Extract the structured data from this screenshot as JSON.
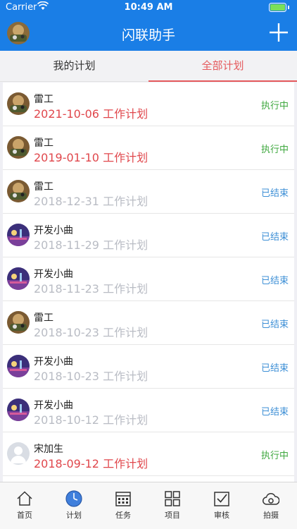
{
  "status_bar": {
    "carrier": "Carrier",
    "time": "10:49 AM"
  },
  "navbar": {
    "title": "闪联助手"
  },
  "tabs": [
    {
      "label": "我的计划",
      "selected": false
    },
    {
      "label": "全部计划",
      "selected": true
    }
  ],
  "plans": [
    {
      "name": "雷工",
      "date": "2021-10-06",
      "suffix": "工作计划",
      "status": "执行中",
      "status_type": "running",
      "avatar": "avatar-photo-1"
    },
    {
      "name": "雷工",
      "date": "2019-01-10",
      "suffix": "工作计划",
      "status": "执行中",
      "status_type": "running",
      "avatar": "avatar-photo-1"
    },
    {
      "name": "雷工",
      "date": "2018-12-31",
      "suffix": "工作计划",
      "status": "已结束",
      "status_type": "ended",
      "avatar": "avatar-photo-1"
    },
    {
      "name": "开发小曲",
      "date": "2018-11-29",
      "suffix": "工作计划",
      "status": "已结束",
      "status_type": "ended",
      "avatar": "avatar-photo-2"
    },
    {
      "name": "开发小曲",
      "date": "2018-11-23",
      "suffix": "工作计划",
      "status": "已结束",
      "status_type": "ended",
      "avatar": "avatar-photo-2"
    },
    {
      "name": "雷工",
      "date": "2018-10-23",
      "suffix": "工作计划",
      "status": "已结束",
      "status_type": "ended",
      "avatar": "avatar-photo-1"
    },
    {
      "name": "开发小曲",
      "date": "2018-10-23",
      "suffix": "工作计划",
      "status": "已结束",
      "status_type": "ended",
      "avatar": "avatar-photo-2"
    },
    {
      "name": "开发小曲",
      "date": "2018-10-12",
      "suffix": "工作计划",
      "status": "已结束",
      "status_type": "ended",
      "avatar": "avatar-photo-2"
    },
    {
      "name": "宋加生",
      "date": "2018-09-12",
      "suffix": "工作计划",
      "status": "执行中",
      "status_type": "running",
      "avatar": "avatar-default"
    }
  ],
  "tab_bar": [
    {
      "label": "首页",
      "icon": "home-icon"
    },
    {
      "label": "计划",
      "icon": "clock-icon"
    },
    {
      "label": "任务",
      "icon": "calendar-icon"
    },
    {
      "label": "项目",
      "icon": "grid-icon"
    },
    {
      "label": "审核",
      "icon": "checkbox-icon"
    },
    {
      "label": "拍摄",
      "icon": "camera-icon"
    }
  ],
  "colors": {
    "brand": "#1a7ee6",
    "accent_red": "#e5595c",
    "status_running": "#3fa83f",
    "status_ended": "#3d8fd6"
  }
}
